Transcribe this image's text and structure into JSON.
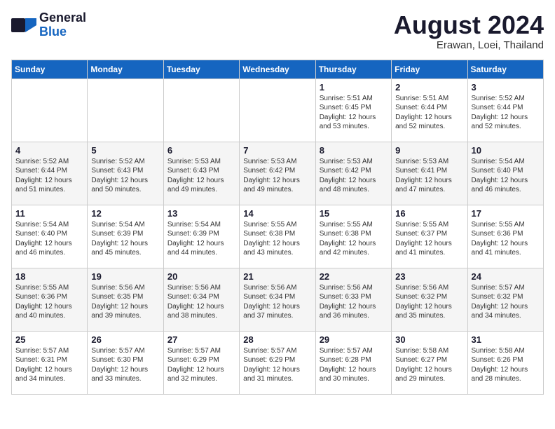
{
  "header": {
    "logo_line1": "General",
    "logo_line2": "Blue",
    "month_title": "August 2024",
    "location": "Erawan, Loei, Thailand"
  },
  "weekdays": [
    "Sunday",
    "Monday",
    "Tuesday",
    "Wednesday",
    "Thursday",
    "Friday",
    "Saturday"
  ],
  "weeks": [
    [
      {
        "day": "",
        "content": ""
      },
      {
        "day": "",
        "content": ""
      },
      {
        "day": "",
        "content": ""
      },
      {
        "day": "",
        "content": ""
      },
      {
        "day": "1",
        "content": "Sunrise: 5:51 AM\nSunset: 6:45 PM\nDaylight: 12 hours\nand 53 minutes."
      },
      {
        "day": "2",
        "content": "Sunrise: 5:51 AM\nSunset: 6:44 PM\nDaylight: 12 hours\nand 52 minutes."
      },
      {
        "day": "3",
        "content": "Sunrise: 5:52 AM\nSunset: 6:44 PM\nDaylight: 12 hours\nand 52 minutes."
      }
    ],
    [
      {
        "day": "4",
        "content": "Sunrise: 5:52 AM\nSunset: 6:44 PM\nDaylight: 12 hours\nand 51 minutes."
      },
      {
        "day": "5",
        "content": "Sunrise: 5:52 AM\nSunset: 6:43 PM\nDaylight: 12 hours\nand 50 minutes."
      },
      {
        "day": "6",
        "content": "Sunrise: 5:53 AM\nSunset: 6:43 PM\nDaylight: 12 hours\nand 49 minutes."
      },
      {
        "day": "7",
        "content": "Sunrise: 5:53 AM\nSunset: 6:42 PM\nDaylight: 12 hours\nand 49 minutes."
      },
      {
        "day": "8",
        "content": "Sunrise: 5:53 AM\nSunset: 6:42 PM\nDaylight: 12 hours\nand 48 minutes."
      },
      {
        "day": "9",
        "content": "Sunrise: 5:53 AM\nSunset: 6:41 PM\nDaylight: 12 hours\nand 47 minutes."
      },
      {
        "day": "10",
        "content": "Sunrise: 5:54 AM\nSunset: 6:40 PM\nDaylight: 12 hours\nand 46 minutes."
      }
    ],
    [
      {
        "day": "11",
        "content": "Sunrise: 5:54 AM\nSunset: 6:40 PM\nDaylight: 12 hours\nand 46 minutes."
      },
      {
        "day": "12",
        "content": "Sunrise: 5:54 AM\nSunset: 6:39 PM\nDaylight: 12 hours\nand 45 minutes."
      },
      {
        "day": "13",
        "content": "Sunrise: 5:54 AM\nSunset: 6:39 PM\nDaylight: 12 hours\nand 44 minutes."
      },
      {
        "day": "14",
        "content": "Sunrise: 5:55 AM\nSunset: 6:38 PM\nDaylight: 12 hours\nand 43 minutes."
      },
      {
        "day": "15",
        "content": "Sunrise: 5:55 AM\nSunset: 6:38 PM\nDaylight: 12 hours\nand 42 minutes."
      },
      {
        "day": "16",
        "content": "Sunrise: 5:55 AM\nSunset: 6:37 PM\nDaylight: 12 hours\nand 41 minutes."
      },
      {
        "day": "17",
        "content": "Sunrise: 5:55 AM\nSunset: 6:36 PM\nDaylight: 12 hours\nand 41 minutes."
      }
    ],
    [
      {
        "day": "18",
        "content": "Sunrise: 5:55 AM\nSunset: 6:36 PM\nDaylight: 12 hours\nand 40 minutes."
      },
      {
        "day": "19",
        "content": "Sunrise: 5:56 AM\nSunset: 6:35 PM\nDaylight: 12 hours\nand 39 minutes."
      },
      {
        "day": "20",
        "content": "Sunrise: 5:56 AM\nSunset: 6:34 PM\nDaylight: 12 hours\nand 38 minutes."
      },
      {
        "day": "21",
        "content": "Sunrise: 5:56 AM\nSunset: 6:34 PM\nDaylight: 12 hours\nand 37 minutes."
      },
      {
        "day": "22",
        "content": "Sunrise: 5:56 AM\nSunset: 6:33 PM\nDaylight: 12 hours\nand 36 minutes."
      },
      {
        "day": "23",
        "content": "Sunrise: 5:56 AM\nSunset: 6:32 PM\nDaylight: 12 hours\nand 35 minutes."
      },
      {
        "day": "24",
        "content": "Sunrise: 5:57 AM\nSunset: 6:32 PM\nDaylight: 12 hours\nand 34 minutes."
      }
    ],
    [
      {
        "day": "25",
        "content": "Sunrise: 5:57 AM\nSunset: 6:31 PM\nDaylight: 12 hours\nand 34 minutes."
      },
      {
        "day": "26",
        "content": "Sunrise: 5:57 AM\nSunset: 6:30 PM\nDaylight: 12 hours\nand 33 minutes."
      },
      {
        "day": "27",
        "content": "Sunrise: 5:57 AM\nSunset: 6:29 PM\nDaylight: 12 hours\nand 32 minutes."
      },
      {
        "day": "28",
        "content": "Sunrise: 5:57 AM\nSunset: 6:29 PM\nDaylight: 12 hours\nand 31 minutes."
      },
      {
        "day": "29",
        "content": "Sunrise: 5:57 AM\nSunset: 6:28 PM\nDaylight: 12 hours\nand 30 minutes."
      },
      {
        "day": "30",
        "content": "Sunrise: 5:58 AM\nSunset: 6:27 PM\nDaylight: 12 hours\nand 29 minutes."
      },
      {
        "day": "31",
        "content": "Sunrise: 5:58 AM\nSunset: 6:26 PM\nDaylight: 12 hours\nand 28 minutes."
      }
    ]
  ]
}
